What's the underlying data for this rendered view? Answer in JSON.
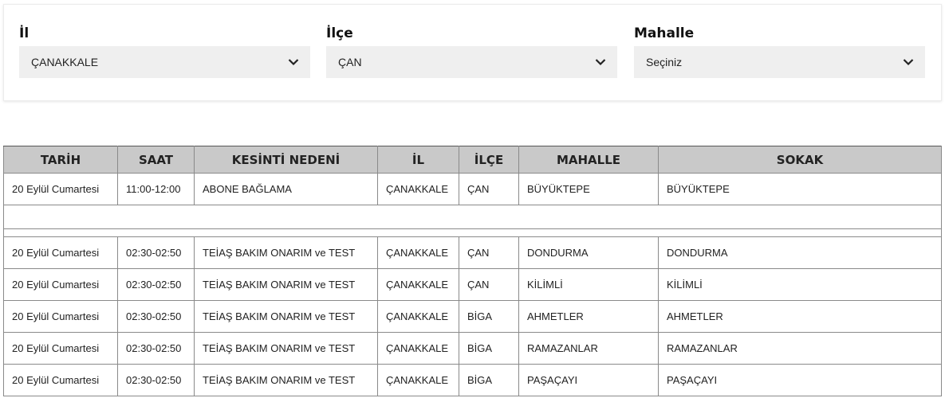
{
  "filters": {
    "il": {
      "label": "İl",
      "value": "ÇANAKKALE"
    },
    "ilce": {
      "label": "İlçe",
      "value": "ÇAN"
    },
    "mahalle": {
      "label": "Mahalle",
      "value": "Seçiniz"
    }
  },
  "table": {
    "headers": [
      "TARİH",
      "SAAT",
      "KESİNTİ NEDENİ",
      "İL",
      "İLÇE",
      "MAHALLE",
      "SOKAK"
    ],
    "rows": [
      [
        "20 Eylül Cumartesi",
        "11:00-12:00",
        "ABONE BAĞLAMA",
        "ÇANAKKALE",
        "ÇAN",
        "BÜYÜKTEPE",
        "BÜYÜKTEPE"
      ],
      [
        "20 Eylül Cumartesi",
        "02:30-02:50",
        "TEİAŞ BAKIM ONARIM ve TEST",
        "ÇANAKKALE",
        "ÇAN",
        "DONDURMA",
        "DONDURMA"
      ],
      [
        "20 Eylül Cumartesi",
        "02:30-02:50",
        "TEİAŞ BAKIM ONARIM ve TEST",
        "ÇANAKKALE",
        "ÇAN",
        "KİLİMLİ",
        "KİLİMLİ"
      ],
      [
        "20 Eylül Cumartesi",
        "02:30-02:50",
        "TEİAŞ BAKIM ONARIM ve TEST",
        "ÇANAKKALE",
        "BİGA",
        "AHMETLER",
        "AHMETLER"
      ],
      [
        "20 Eylül Cumartesi",
        "02:30-02:50",
        "TEİAŞ BAKIM ONARIM ve TEST",
        "ÇANAKKALE",
        "BİGA",
        "RAMAZANLAR",
        "RAMAZANLAR"
      ],
      [
        "20 Eylül Cumartesi",
        "02:30-02:50",
        "TEİAŞ BAKIM ONARIM ve TEST",
        "ÇANAKKALE",
        "BİGA",
        "PAŞAÇAYI",
        "PAŞAÇAYI"
      ]
    ]
  },
  "icons": {
    "dropdown": "chevron-down-icon"
  }
}
